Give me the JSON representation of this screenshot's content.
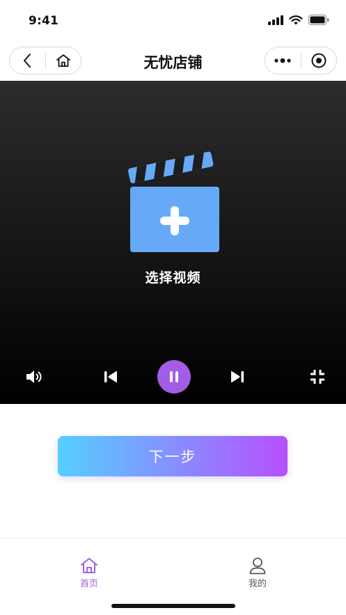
{
  "status_bar": {
    "time": "9:41",
    "icons": [
      "signal-icon",
      "wifi-icon",
      "battery-icon"
    ]
  },
  "nav": {
    "title": "无忧店铺",
    "left_icons": [
      "back-icon",
      "home-icon"
    ],
    "right_icons": [
      "more-icon",
      "record-icon"
    ]
  },
  "player": {
    "placeholder_icon": "clapperboard-plus-icon",
    "select_label": "选择视频",
    "controls": [
      "volume-icon",
      "previous-icon",
      "pause-icon",
      "next-icon",
      "exit-fullscreen-icon"
    ],
    "accent": "#a35ce6",
    "clapper_color": "#66aaf7"
  },
  "next_button": {
    "label": "下一步",
    "gradient": [
      "#55cfff",
      "#b650ff"
    ]
  },
  "tab_bar": {
    "tabs": [
      {
        "label": "首页",
        "icon": "home-icon",
        "active": true
      },
      {
        "label": "我的",
        "icon": "person-icon",
        "active": false
      }
    ],
    "active_color": "#a35ce6"
  }
}
